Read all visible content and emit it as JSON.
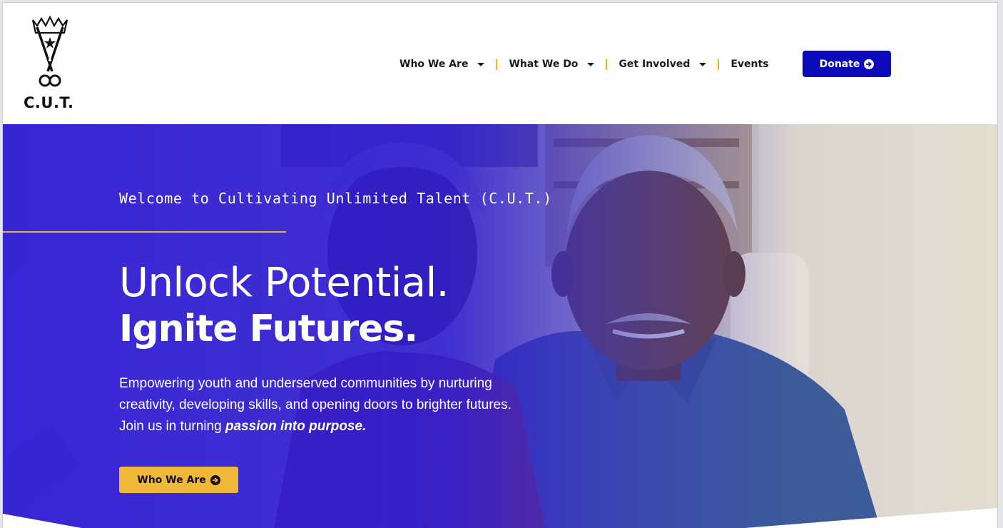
{
  "brand": {
    "logo_text": "C.U.T."
  },
  "nav": {
    "items": [
      {
        "label": "Who We Are",
        "dropdown": true
      },
      {
        "label": "What We Do",
        "dropdown": true
      },
      {
        "label": "Get Involved",
        "dropdown": true
      },
      {
        "label": "Events",
        "dropdown": false
      }
    ],
    "donate_label": "Donate",
    "donate_icon": "arrow-circle-right-icon"
  },
  "hero": {
    "welcome": "Welcome to Cultivating Unlimited Talent (C.U.T.)",
    "headline_line1": "Unlock Potential.",
    "headline_line2": "Ignite Futures.",
    "description": "Empowering youth and underserved communities by nurturing creativity, developing skills, and opening doors to brighter futures. Join us in turning",
    "description_emphasis": "passion into purpose.",
    "cta_label": "Who We Are",
    "cta_icon": "arrow-circle-right-icon"
  },
  "colors": {
    "primary_blue": "#0c0ab8",
    "accent_gold": "#f0b838",
    "overlay_blue": "#2c18d6",
    "separator": "#f2b705"
  }
}
